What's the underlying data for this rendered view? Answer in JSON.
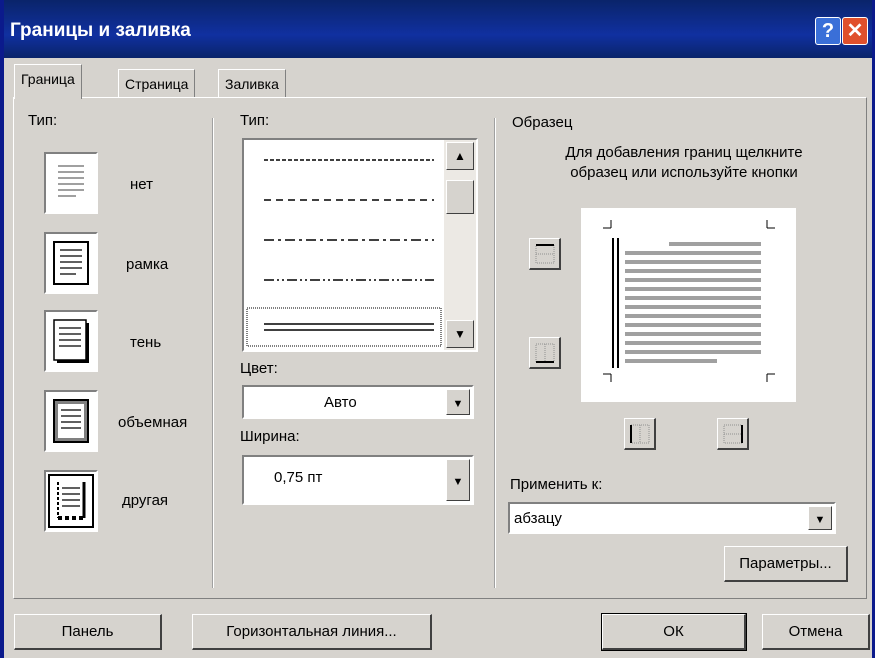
{
  "window": {
    "title": "Границы и заливка",
    "help": "?",
    "close": "✕"
  },
  "tabs": [
    "Граница",
    "Страница",
    "Заливка"
  ],
  "type_section": {
    "label": "Тип:",
    "presets": [
      {
        "label": "нет",
        "icon": "preset-none-icon"
      },
      {
        "label": "рамка",
        "icon": "preset-box-icon"
      },
      {
        "label": "тень",
        "icon": "preset-shadow-icon"
      },
      {
        "label": "объемная",
        "icon": "preset-3d-icon"
      },
      {
        "label": "другая",
        "icon": "preset-custom-icon"
      }
    ]
  },
  "style_section": {
    "type_label": "Тип:",
    "color_label": "Цвет:",
    "color_value": "Авто",
    "width_label": "Ширина:",
    "width_value": "0,75 пт"
  },
  "sample": {
    "label": "Образец",
    "hint": "Для добавления границ щелкните\nобразец или используйте кнопки",
    "apply_label": "Применить к:",
    "apply_value": "абзацу",
    "options_button": "Параметры..."
  },
  "footer": {
    "panel_button": "Панель",
    "hline_button": "Горизонтальная линия...",
    "ok_button": "ОК",
    "cancel_button": "Отмена"
  },
  "colors": {
    "titlebar": "#0a246a",
    "dialog": "#d6d3ce",
    "desktop": "#0b1a8c"
  }
}
